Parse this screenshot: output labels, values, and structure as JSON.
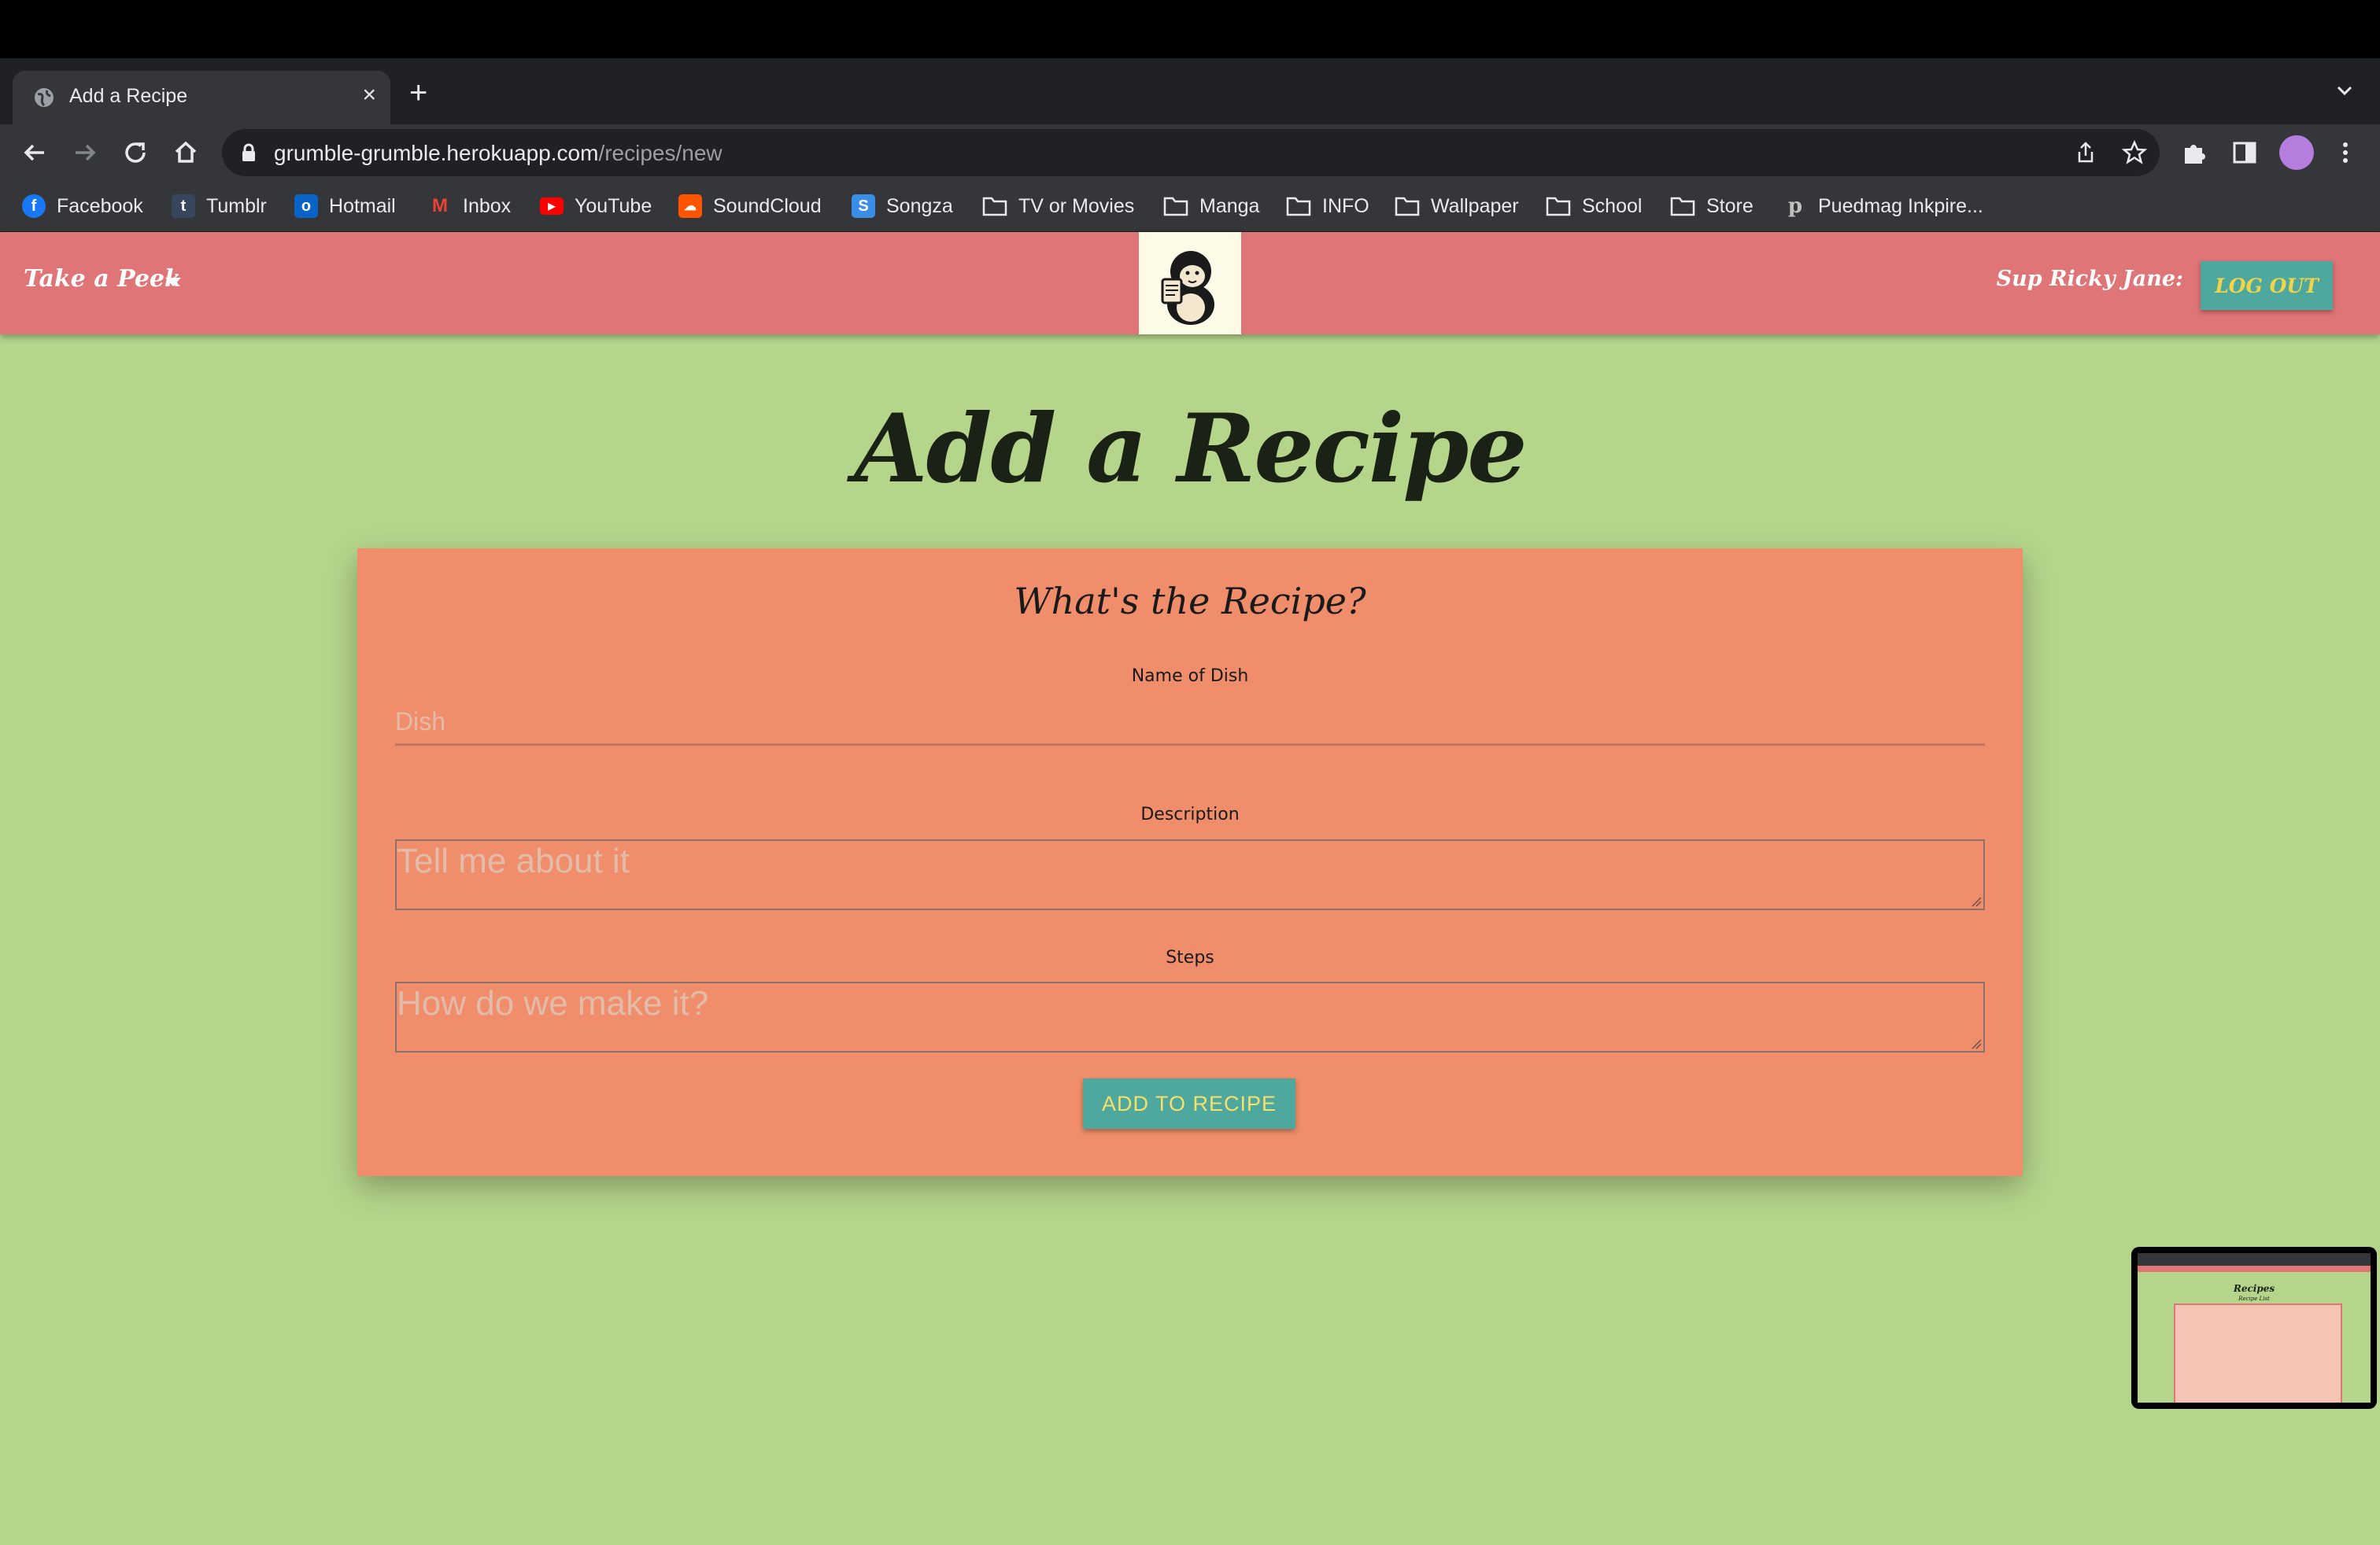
{
  "browser": {
    "tab_title": "Add a Recipe",
    "url_host": "grumble-grumble.herokuapp.com",
    "url_path": "/recipes/new",
    "bookmarks": [
      "Facebook",
      "Tumblr",
      "Hotmail",
      "Inbox",
      "YouTube",
      "SoundCloud",
      "Songza",
      "TV or Movies",
      "Manga",
      "INFO",
      "Wallpaper",
      "School",
      "Store",
      "Puedmag Inkpire..."
    ]
  },
  "nav": {
    "menu_label": "Take a Peek",
    "greeting": "Sup Ricky Jane:",
    "logout_label": "LOG OUT"
  },
  "page": {
    "title": "Add a Recipe"
  },
  "form": {
    "heading": "What's the Recipe?",
    "dish_label": "Name of Dish",
    "dish_placeholder": "Dish",
    "description_label": "Description",
    "description_placeholder": "Tell me about it",
    "steps_label": "Steps",
    "steps_placeholder": "How do we make it?",
    "submit_label": "ADD TO RECIPE"
  },
  "thumbnail": {
    "title": "Recipes",
    "subtitle": "Recipe List"
  },
  "colors": {
    "background": "#b5d58b",
    "navbar": "#df7577",
    "card": "#f08d6b",
    "button": "#4ea89e",
    "button_text": "#f6e06a"
  }
}
